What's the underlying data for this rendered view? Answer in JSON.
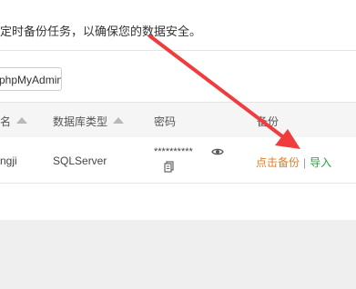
{
  "notice": {
    "text": "定时备份任务，以确保您的数据安全。"
  },
  "toolbar": {
    "phpmyadmin_label": "phpMyAdmin"
  },
  "table": {
    "headers": [
      "名",
      "数据库类型",
      "密码",
      "备份"
    ],
    "rows": [
      {
        "name": "ngji",
        "type": "SQLServer",
        "password_mask": "**********",
        "backup_label": "点击备份",
        "separator": "|",
        "import_label": "导入"
      }
    ]
  },
  "annotation": {
    "arrow_color": "#f03c3c"
  },
  "icons": {
    "view_password": "eye-icon",
    "copy_password": "copy-icon"
  }
}
